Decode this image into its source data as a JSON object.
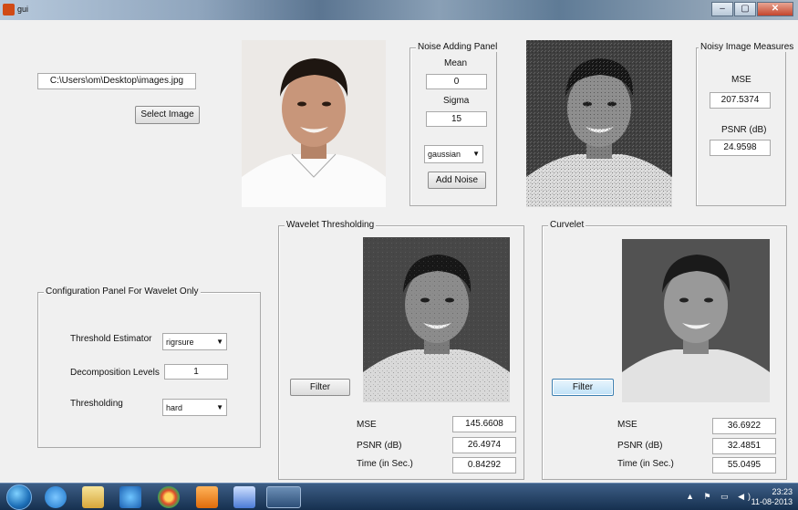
{
  "window": {
    "title": "gui",
    "min": "–",
    "max": "▢",
    "close": "✕"
  },
  "input_panel": {
    "path_value": "C:\\Users\\om\\Desktop\\images.jpg",
    "select_image_label": "Select Image"
  },
  "noise_panel": {
    "title": "Noise Adding Panel",
    "mean_label": "Mean",
    "mean_value": "0",
    "sigma_label": "Sigma",
    "sigma_value": "15",
    "noise_type": "gaussian",
    "add_noise_label": "Add Noise"
  },
  "noisy_measures": {
    "title": "Noisy Image Measures",
    "mse_label": "MSE",
    "mse_value": "207.5374",
    "psnr_label": "PSNR (dB)",
    "psnr_value": "24.9598"
  },
  "config_panel": {
    "title": "Configuration Panel For Wavelet Only",
    "threshold_estimator_label": "Threshold Estimator",
    "threshold_estimator_value": "rigrsure",
    "decomposition_levels_label": "Decomposition Levels",
    "decomposition_levels_value": "1",
    "thresholding_label": "Thresholding",
    "thresholding_value": "hard"
  },
  "wavelet_panel": {
    "title": "Wavelet Thresholding",
    "filter_label": "Filter",
    "mse_label": "MSE",
    "mse_value": "145.6608",
    "psnr_label": "PSNR (dB)",
    "psnr_value": "26.4974",
    "time_label": "Time (in Sec.)",
    "time_value": "0.84292"
  },
  "curvelet_panel": {
    "title": "Curvelet",
    "filter_label": "Filter",
    "mse_label": "MSE",
    "mse_value": "36.6922",
    "psnr_label": "PSNR (dB)",
    "psnr_value": "32.4851",
    "time_label": "Time (in Sec.)",
    "time_value": "55.0495"
  },
  "taskbar": {
    "time": "23:23",
    "date": "11-08-2013",
    "icons": [
      "start-orb-icon",
      "internet-explorer-icon",
      "file-explorer-icon",
      "media-player-icon",
      "chrome-icon",
      "vlc-icon",
      "word-icon",
      "matlab-icon"
    ]
  },
  "colors": {
    "focus_blue": "#3c7fb1",
    "taskbar": "#1f3a5c"
  }
}
